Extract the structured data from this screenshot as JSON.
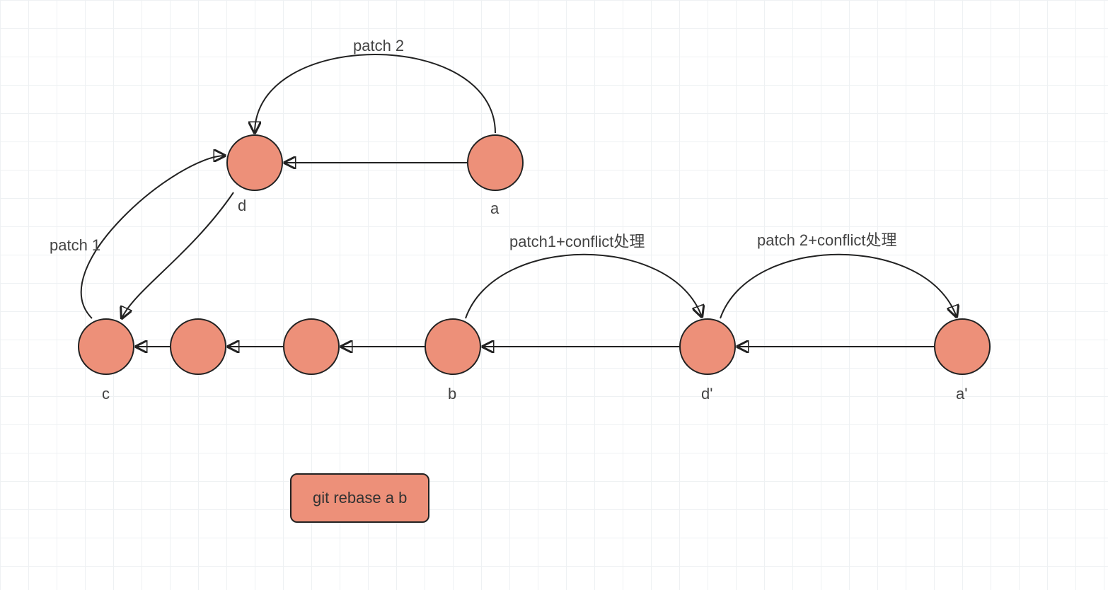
{
  "nodes": {
    "d": {
      "label": "d"
    },
    "a": {
      "label": "a"
    },
    "c": {
      "label": "c"
    },
    "n2": {
      "label": ""
    },
    "n3": {
      "label": ""
    },
    "b": {
      "label": "b"
    },
    "dp": {
      "label": "d'"
    },
    "ap": {
      "label": "a'"
    }
  },
  "edge_labels": {
    "patch1": "patch 1",
    "patch2": "patch 2",
    "patch1_conflict": "patch1+conflict处理",
    "patch2_conflict": "patch 2+conflict处理"
  },
  "command": "git rebase a b"
}
